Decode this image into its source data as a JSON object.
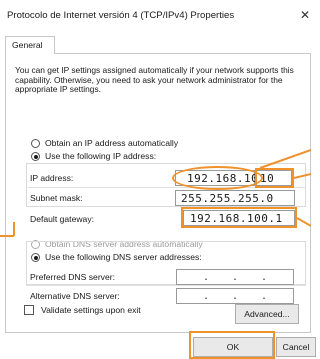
{
  "window": {
    "title": "Protocolo de Internet versión 4 (TCP/IPv4) Properties",
    "close_icon": "close-icon"
  },
  "tabs": [
    {
      "label": "General",
      "selected": true
    }
  ],
  "description": "You can get IP settings assigned automatically if your network supports this capability. Otherwise, you need to ask your network administrator for the appropriate IP settings.",
  "ip_section": {
    "auto_option": "Obtain an IP address automatically",
    "manual_option": "Use the following IP address:",
    "selected": "manual",
    "ip_address": {
      "label": "IP address:",
      "value": "192.168.100.",
      "last_octet": "10"
    },
    "subnet_mask": {
      "label": "Subnet mask:",
      "value": "255.255.255.0"
    },
    "default_gateway": {
      "label": "Default gateway:",
      "value": "192.168.100.1"
    }
  },
  "dns_section": {
    "auto_option": "Obtain DNS server address automatically",
    "manual_option": "Use the following DNS server addresses:",
    "selected": "manual",
    "preferred": {
      "label": "Preferred DNS server:",
      "value": ""
    },
    "alternative": {
      "label": "Alternative DNS server:",
      "value": ""
    }
  },
  "validate_on_exit": {
    "label": "Validate settings upon exit",
    "checked": false
  },
  "buttons": {
    "advanced": "Advanced...",
    "ok": "OK",
    "cancel": "Cancel"
  },
  "colors": {
    "annotation": "#f0922b",
    "button_bg": "#e9e9e9",
    "border": "#c8c8c8"
  }
}
